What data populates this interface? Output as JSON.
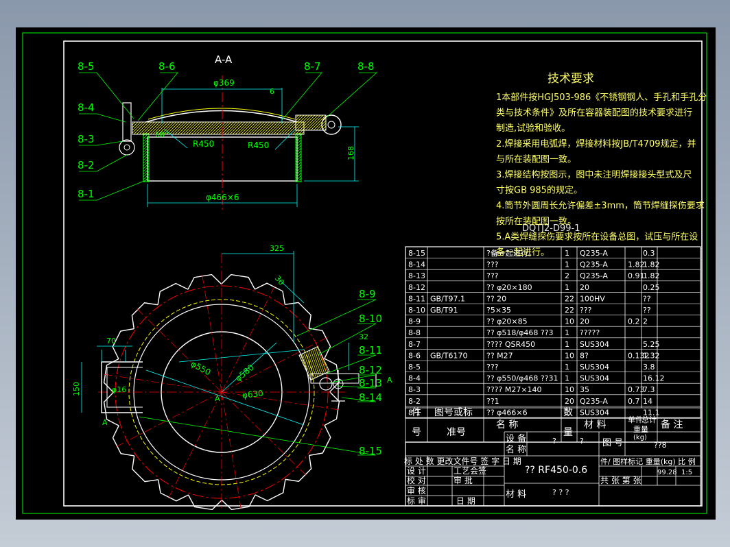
{
  "section_title": "A-A",
  "callouts": [
    "8-5",
    "8-6",
    "8-7",
    "8-8",
    "8-4",
    "8-3",
    "8-2",
    "8-1",
    "8-9",
    "8-10",
    "8-11",
    "8-12",
    "8-13",
    "8-14",
    "8-15"
  ],
  "dims": {
    "d369": "φ369",
    "six": "6",
    "r1": "R450",
    "r2": "R450",
    "ang": "60°",
    "h168": "168",
    "d466": "φ466×6",
    "d325": "325",
    "d30": "30",
    "d32": "32",
    "d70": "70",
    "d150": "150",
    "d16": "φ16",
    "d550": "φ550",
    "d580": "φ580",
    "d630": "φ630",
    "markA": "A",
    "markA2": "A",
    "markA3": "A"
  },
  "tech": {
    "title": "技术要求",
    "lines": [
      "1本部件按HGJ503-986《不锈钢钢人、手孔和手孔分",
      "类与技术条件》及所在容器装配图的技术要求进行",
      "制造,试验和验收。",
      "2.焊接采用电弧焊，焊接材料按JB/T4709规定，并",
      "与所在装配图一致。",
      "3.焊接结构按图示，图中未注明焊接接头型式及尺",
      "寸按GB 985的规定。",
      "4.筒节外圆周长允许偏差±3mm，筒节焊缝探伤要求",
      "按所在装配图一致。",
      "5.A类焊缝探伤要求按所在设备总图，试压与所在设",
      "备一起进行。"
    ],
    "overlap": "DQTJ2-D99-1"
  },
  "bom": [
    {
      "no": "8-15",
      "std": "",
      "name": "?备一起进行。",
      "qty": "1",
      "mat": "Q235-A",
      "w1": "",
      "w2": "0.3"
    },
    {
      "no": "8-14",
      "std": "",
      "name": "???",
      "qty": "1",
      "mat": "Q235-A",
      "w1": "1.82",
      "w2": "1.82"
    },
    {
      "no": "8-13",
      "std": "",
      "name": "???",
      "qty": "2",
      "mat": "Q235-A",
      "w1": "0.91",
      "w2": "1.82"
    },
    {
      "no": "8-12",
      "std": "",
      "name": "?? φ20×180",
      "qty": "1",
      "mat": "20",
      "w1": "",
      "w2": "0.25"
    },
    {
      "no": "8-11",
      "std": "GB/T97.1",
      "name": "?? 20",
      "qty": "22",
      "mat": "100HV",
      "w1": "",
      "w2": "??"
    },
    {
      "no": "8-10",
      "std": "GB/T91",
      "name": "?5×35",
      "qty": "22",
      "mat": "???",
      "w1": "",
      "w2": "??"
    },
    {
      "no": "8-9",
      "std": "",
      "name": "?? φ20×85",
      "qty": "10",
      "mat": "20",
      "w1": "0.2",
      "w2": "2"
    },
    {
      "no": "8-8",
      "std": "",
      "name": "?? φ518/φ468 ??3",
      "qty": "1",
      "mat": "?????",
      "w1": "",
      "w2": ""
    },
    {
      "no": "8-7",
      "std": "",
      "name": "???? QSR450",
      "qty": "1",
      "mat": "SUS304",
      "w1": "",
      "w2": "5.25"
    },
    {
      "no": "8-6",
      "std": "GB/T6170",
      "name": "?? M27",
      "qty": "10",
      "mat": "8?",
      "w1": "0.132",
      "w2": "1.32"
    },
    {
      "no": "8-5",
      "std": "",
      "name": "???",
      "qty": "1",
      "mat": "SUS304",
      "w1": "",
      "w2": "3.8"
    },
    {
      "no": "8-4",
      "std": "",
      "name": "?? φ550/φ468 ??31",
      "qty": "1",
      "mat": "SUS304",
      "w1": "",
      "w2": "16.12"
    },
    {
      "no": "8-3",
      "std": "",
      "name": "???? M27×140",
      "qty": "10",
      "mat": "35",
      "w1": "0.73",
      "w2": "7.3"
    },
    {
      "no": "8-2",
      "std": "",
      "name": "??1",
      "qty": "20",
      "mat": "Q235-A",
      "w1": "0.7",
      "w2": "14"
    },
    {
      "no": "8-1",
      "std": "",
      "name": "?? φ466×6",
      "qty": "1",
      "mat": "SUS304",
      "w1": "",
      "w2": "11.1"
    }
  ],
  "bom_header": {
    "c1": "件",
    "c1b": "号",
    "c2": "图号或标",
    "c2b": "准号",
    "c3": "名      称",
    "c4": "数",
    "c4b": "量",
    "c5": "材  料",
    "c6": "单件",
    "c6b": "总计",
    "c6c": "重量",
    "c6d": "(kg)",
    "c7": "备    注"
  },
  "title_block": {
    "design_label": "设 备",
    "design_val": "?",
    "design_val2": "?",
    "name_label": "名 称",
    "drawing_no_label": "图 号",
    "drawing_no_val": "??8",
    "part_name": "?? RF450-0.6",
    "material_label": "材 料",
    "material_val": "? ? ?",
    "row_marks": "标 处 数 更改文件号 签 字 日 期",
    "scale_hdr": "件/ 图样标记 重量(kg) 比 例",
    "weight": "99.28",
    "scale": "1:5",
    "sheets": "共      张  第      张",
    "l_design": "设 计",
    "l_check": "校 对",
    "l_review": "审 核",
    "l_std": "标 审",
    "l_process": "工艺会签",
    "l_approve": "审 批",
    "l_date": "日 期"
  }
}
